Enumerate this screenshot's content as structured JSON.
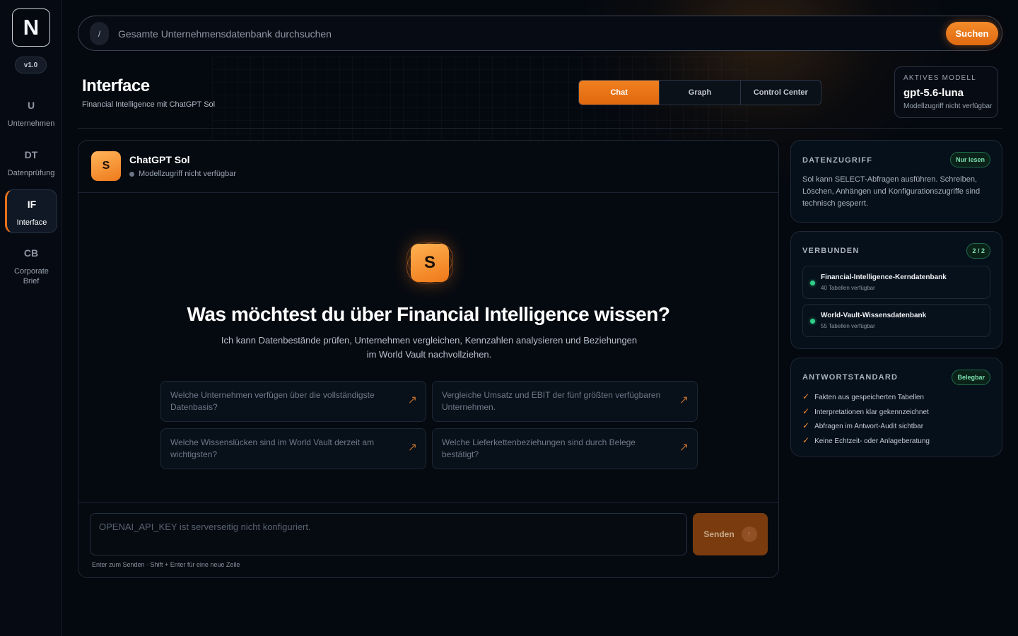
{
  "sidebar": {
    "logo": "N",
    "version": "v1.0",
    "items": [
      {
        "abbr": "U",
        "label": "Unternehmen"
      },
      {
        "abbr": "DT",
        "label": "Datenprüfung"
      },
      {
        "abbr": "IF",
        "label": "Interface"
      },
      {
        "abbr": "CB",
        "label": "Corporate Brief"
      }
    ]
  },
  "search": {
    "shortcut": "/",
    "placeholder": "Gesamte Unternehmensdatenbank durchsuchen",
    "button": "Suchen"
  },
  "header": {
    "title": "Interface",
    "subtitle": "Financial Intelligence mit ChatGPT Sol",
    "tabs": [
      "Chat",
      "Graph",
      "Control Center"
    ],
    "model": {
      "label": "AKTIVES MODELL",
      "name": "gpt-5.6-luna",
      "status": "Modellzugriff nicht verfügbar"
    }
  },
  "chat": {
    "avatar": "S",
    "name": "ChatGPT Sol",
    "status": "Modellzugriff nicht verfügbar",
    "hero_avatar": "S",
    "hero_title": "Was möchtest du über Financial Intelligence wissen?",
    "hero_desc": "Ich kann Datenbestände prüfen, Unternehmen vergleichen, Kennzahlen analysieren und Beziehungen im World Vault nachvollziehen.",
    "suggestions": [
      "Welche Unternehmen verfügen über die vollständigste Datenbasis?",
      "Vergleiche Umsatz und EBIT der fünf größten verfügbaren Unternehmen.",
      "Welche Wissenslücken sind im World Vault derzeit am wichtigsten?",
      "Welche Lieferkettenbeziehungen sind durch Belege bestätigt?"
    ],
    "input_placeholder": "OPENAI_API_KEY ist serverseitig nicht konfiguriert.",
    "send": "Senden",
    "send_icon": "↑",
    "hint": "Enter zum Senden · Shift + Enter für eine neue Zeile"
  },
  "panels": {
    "access": {
      "title": "DATENZUGRIFF",
      "badge": "Nur lesen",
      "text": "Sol kann SELECT-Abfragen ausführen. Schreiben, Löschen, Anhängen und Konfigurationszugriffe sind technisch gesperrt."
    },
    "connected": {
      "title": "VERBUNDEN",
      "badge": "2 / 2",
      "items": [
        {
          "name": "Financial-Intelligence-Kerndatenbank",
          "sub": "40 Tabellen verfügbar"
        },
        {
          "name": "World-Vault-Wissensdatenbank",
          "sub": "55 Tabellen verfügbar"
        }
      ]
    },
    "standard": {
      "title": "ANTWORTSTANDARD",
      "badge": "Belegbar",
      "items": [
        "Fakten aus gespeicherten Tabellen",
        "Interpretationen klar gekennzeichnet",
        "Abfragen im Antwort-Audit sichtbar",
        "Keine Echtzeit- oder Anlageberatung"
      ]
    }
  },
  "colors": {
    "accent": "#ee7a1c",
    "background": "#04080f",
    "success": "#2fd08a"
  },
  "icons": {
    "suggestion_arrow": "arrow-up-right-icon",
    "check": "check-icon",
    "status_dot": "status-dot-icon"
  }
}
